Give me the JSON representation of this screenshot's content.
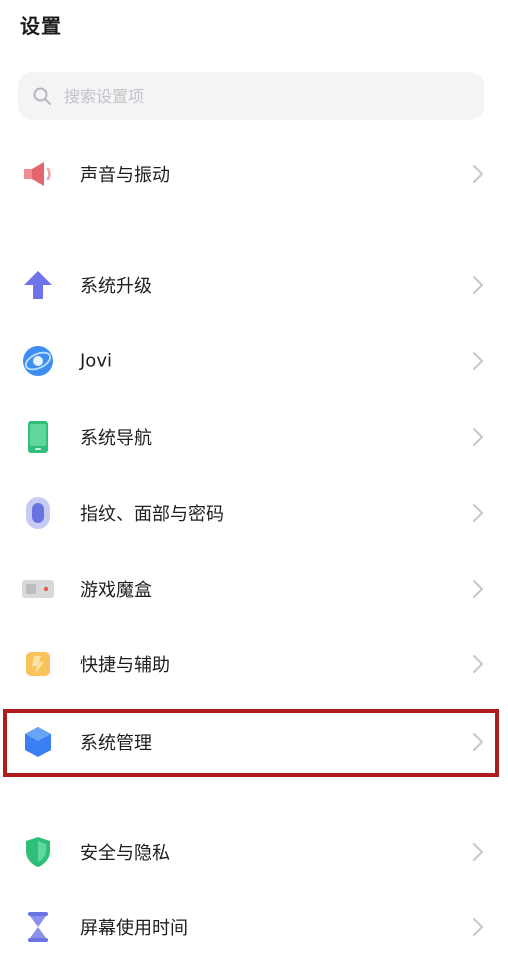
{
  "header": {
    "title": "设置"
  },
  "search": {
    "placeholder": "搜索设置项",
    "icon": "search-icon"
  },
  "items": [
    {
      "id": "sound",
      "label": "声音与振动",
      "icon": "speaker-icon"
    },
    {
      "id": "update",
      "label": "系统升级",
      "icon": "arrow-up-icon"
    },
    {
      "id": "jovi",
      "label": "Jovi",
      "icon": "jovi-icon"
    },
    {
      "id": "nav",
      "label": "系统导航",
      "icon": "phone-nav-icon"
    },
    {
      "id": "fingerprint",
      "label": "指纹、面部与密码",
      "icon": "fingerprint-icon"
    },
    {
      "id": "game",
      "label": "游戏魔盒",
      "icon": "game-box-icon"
    },
    {
      "id": "shortcut",
      "label": "快捷与辅助",
      "icon": "shortcut-icon"
    },
    {
      "id": "sysmgmt",
      "label": "系统管理",
      "icon": "hexagon-shield-icon",
      "highlighted": true
    },
    {
      "id": "privacy",
      "label": "安全与隐私",
      "icon": "shield-icon"
    },
    {
      "id": "screentime",
      "label": "屏幕使用时间",
      "icon": "hourglass-icon"
    }
  ],
  "colors": {
    "highlight_border": "#b01c1c",
    "chevron": "#c8c8cc"
  }
}
